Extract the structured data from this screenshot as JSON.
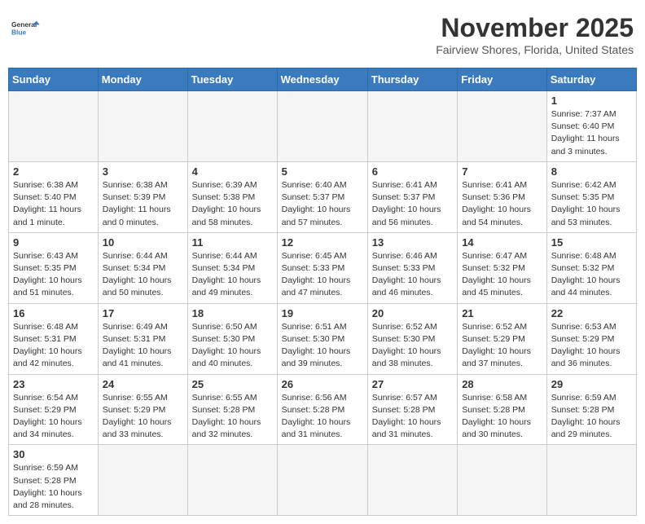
{
  "header": {
    "logo_general": "General",
    "logo_blue": "Blue",
    "month_title": "November 2025",
    "location": "Fairview Shores, Florida, United States"
  },
  "weekdays": [
    "Sunday",
    "Monday",
    "Tuesday",
    "Wednesday",
    "Thursday",
    "Friday",
    "Saturday"
  ],
  "weeks": [
    [
      {
        "day": "",
        "info": ""
      },
      {
        "day": "",
        "info": ""
      },
      {
        "day": "",
        "info": ""
      },
      {
        "day": "",
        "info": ""
      },
      {
        "day": "",
        "info": ""
      },
      {
        "day": "",
        "info": ""
      },
      {
        "day": "1",
        "info": "Sunrise: 7:37 AM\nSunset: 6:40 PM\nDaylight: 11 hours\nand 3 minutes."
      }
    ],
    [
      {
        "day": "2",
        "info": "Sunrise: 6:38 AM\nSunset: 5:40 PM\nDaylight: 11 hours\nand 1 minute."
      },
      {
        "day": "3",
        "info": "Sunrise: 6:38 AM\nSunset: 5:39 PM\nDaylight: 11 hours\nand 0 minutes."
      },
      {
        "day": "4",
        "info": "Sunrise: 6:39 AM\nSunset: 5:38 PM\nDaylight: 10 hours\nand 58 minutes."
      },
      {
        "day": "5",
        "info": "Sunrise: 6:40 AM\nSunset: 5:37 PM\nDaylight: 10 hours\nand 57 minutes."
      },
      {
        "day": "6",
        "info": "Sunrise: 6:41 AM\nSunset: 5:37 PM\nDaylight: 10 hours\nand 56 minutes."
      },
      {
        "day": "7",
        "info": "Sunrise: 6:41 AM\nSunset: 5:36 PM\nDaylight: 10 hours\nand 54 minutes."
      },
      {
        "day": "8",
        "info": "Sunrise: 6:42 AM\nSunset: 5:35 PM\nDaylight: 10 hours\nand 53 minutes."
      }
    ],
    [
      {
        "day": "9",
        "info": "Sunrise: 6:43 AM\nSunset: 5:35 PM\nDaylight: 10 hours\nand 51 minutes."
      },
      {
        "day": "10",
        "info": "Sunrise: 6:44 AM\nSunset: 5:34 PM\nDaylight: 10 hours\nand 50 minutes."
      },
      {
        "day": "11",
        "info": "Sunrise: 6:44 AM\nSunset: 5:34 PM\nDaylight: 10 hours\nand 49 minutes."
      },
      {
        "day": "12",
        "info": "Sunrise: 6:45 AM\nSunset: 5:33 PM\nDaylight: 10 hours\nand 47 minutes."
      },
      {
        "day": "13",
        "info": "Sunrise: 6:46 AM\nSunset: 5:33 PM\nDaylight: 10 hours\nand 46 minutes."
      },
      {
        "day": "14",
        "info": "Sunrise: 6:47 AM\nSunset: 5:32 PM\nDaylight: 10 hours\nand 45 minutes."
      },
      {
        "day": "15",
        "info": "Sunrise: 6:48 AM\nSunset: 5:32 PM\nDaylight: 10 hours\nand 44 minutes."
      }
    ],
    [
      {
        "day": "16",
        "info": "Sunrise: 6:48 AM\nSunset: 5:31 PM\nDaylight: 10 hours\nand 42 minutes."
      },
      {
        "day": "17",
        "info": "Sunrise: 6:49 AM\nSunset: 5:31 PM\nDaylight: 10 hours\nand 41 minutes."
      },
      {
        "day": "18",
        "info": "Sunrise: 6:50 AM\nSunset: 5:30 PM\nDaylight: 10 hours\nand 40 minutes."
      },
      {
        "day": "19",
        "info": "Sunrise: 6:51 AM\nSunset: 5:30 PM\nDaylight: 10 hours\nand 39 minutes."
      },
      {
        "day": "20",
        "info": "Sunrise: 6:52 AM\nSunset: 5:30 PM\nDaylight: 10 hours\nand 38 minutes."
      },
      {
        "day": "21",
        "info": "Sunrise: 6:52 AM\nSunset: 5:29 PM\nDaylight: 10 hours\nand 37 minutes."
      },
      {
        "day": "22",
        "info": "Sunrise: 6:53 AM\nSunset: 5:29 PM\nDaylight: 10 hours\nand 36 minutes."
      }
    ],
    [
      {
        "day": "23",
        "info": "Sunrise: 6:54 AM\nSunset: 5:29 PM\nDaylight: 10 hours\nand 34 minutes."
      },
      {
        "day": "24",
        "info": "Sunrise: 6:55 AM\nSunset: 5:29 PM\nDaylight: 10 hours\nand 33 minutes."
      },
      {
        "day": "25",
        "info": "Sunrise: 6:55 AM\nSunset: 5:28 PM\nDaylight: 10 hours\nand 32 minutes."
      },
      {
        "day": "26",
        "info": "Sunrise: 6:56 AM\nSunset: 5:28 PM\nDaylight: 10 hours\nand 31 minutes."
      },
      {
        "day": "27",
        "info": "Sunrise: 6:57 AM\nSunset: 5:28 PM\nDaylight: 10 hours\nand 31 minutes."
      },
      {
        "day": "28",
        "info": "Sunrise: 6:58 AM\nSunset: 5:28 PM\nDaylight: 10 hours\nand 30 minutes."
      },
      {
        "day": "29",
        "info": "Sunrise: 6:59 AM\nSunset: 5:28 PM\nDaylight: 10 hours\nand 29 minutes."
      }
    ],
    [
      {
        "day": "30",
        "info": "Sunrise: 6:59 AM\nSunset: 5:28 PM\nDaylight: 10 hours\nand 28 minutes."
      },
      {
        "day": "",
        "info": ""
      },
      {
        "day": "",
        "info": ""
      },
      {
        "day": "",
        "info": ""
      },
      {
        "day": "",
        "info": ""
      },
      {
        "day": "",
        "info": ""
      },
      {
        "day": "",
        "info": ""
      }
    ]
  ]
}
